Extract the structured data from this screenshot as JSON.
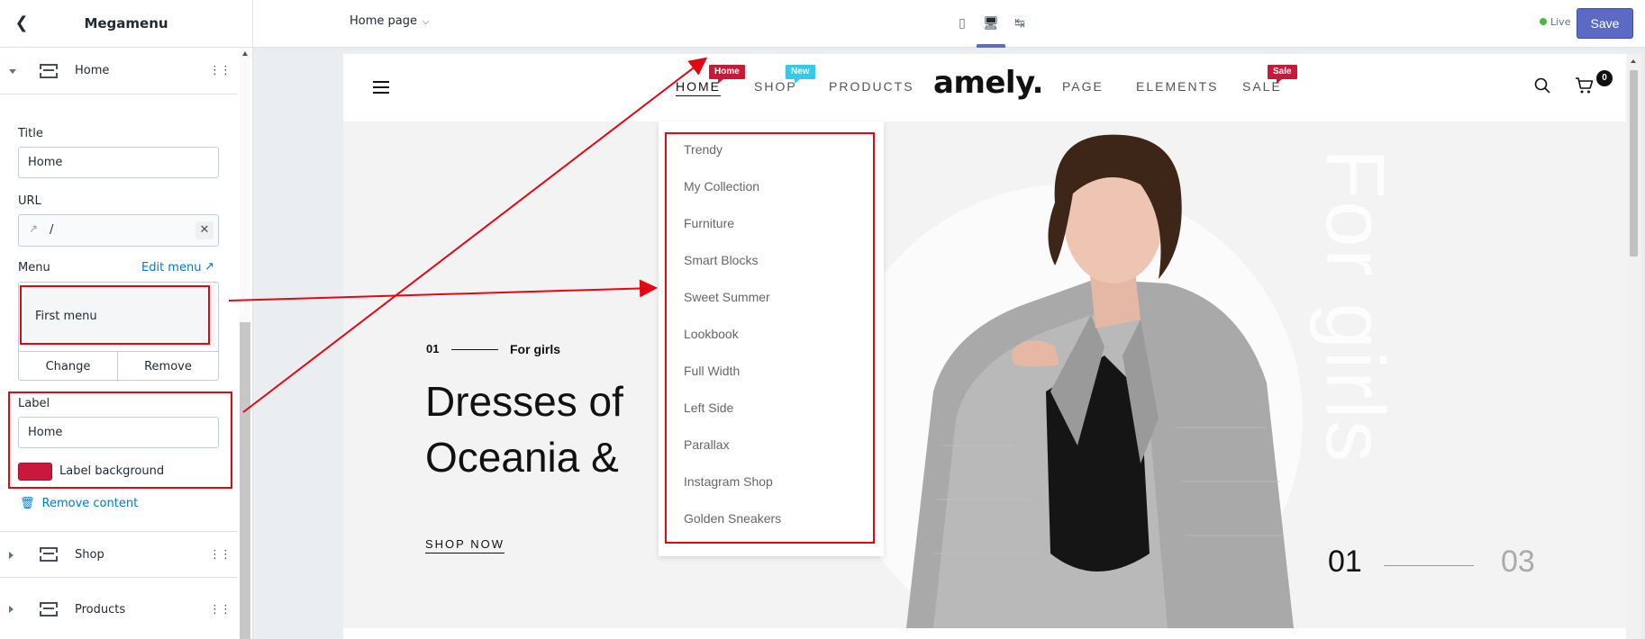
{
  "sidebar": {
    "title": "Megamenu",
    "blocks": [
      {
        "label": "Home",
        "expanded": true
      },
      {
        "label": "Shop",
        "expanded": false
      },
      {
        "label": "Products",
        "expanded": false
      }
    ],
    "title_field": {
      "label": "Title",
      "value": "Home"
    },
    "url_field": {
      "label": "URL",
      "value": "/"
    },
    "menu_field": {
      "label": "Menu",
      "edit_link": "Edit menu",
      "selected": "First menu",
      "change_label": "Change",
      "remove_label": "Remove"
    },
    "label_field": {
      "label": "Label",
      "value": "Home"
    },
    "label_background": {
      "label": "Label background",
      "color": "#c9193a"
    },
    "remove_content": "Remove content"
  },
  "topbar": {
    "page_select": "Home page",
    "devices": [
      "mobile-icon",
      "desktop-icon",
      "full-width-icon"
    ],
    "active_device": "desktop-icon",
    "status": "Live",
    "save_label": "Save",
    "accent": "#5c6ac4"
  },
  "store": {
    "logo": "amely.",
    "nav": [
      {
        "label": "HOME",
        "badge": "Home",
        "badge_color": "#c9193a",
        "active": true
      },
      {
        "label": "SHOP",
        "badge": "New",
        "badge_color": "#39c8ea"
      },
      {
        "label": "PRODUCTS"
      },
      {
        "label": "PAGE"
      },
      {
        "label": "ELEMENTS"
      },
      {
        "label": "SALE",
        "badge": "Sale",
        "badge_color": "#c9193a"
      }
    ],
    "cart_count": "0",
    "dropdown": [
      "Trendy",
      "My Collection",
      "Furniture",
      "Smart Blocks",
      "Sweet Summer",
      "Lookbook",
      "Full Width",
      "Left Side",
      "Parallax",
      "Instagram Shop",
      "Golden Sneakers"
    ],
    "hero": {
      "number": "01",
      "tag": "For girls",
      "title_line1": "Dresses of",
      "title_line2": "Oceania &",
      "cta": "SHOP NOW",
      "vertical_text": "For girls",
      "slide_current": "01",
      "slide_total": "03"
    }
  },
  "annotation_color": "#e30613"
}
